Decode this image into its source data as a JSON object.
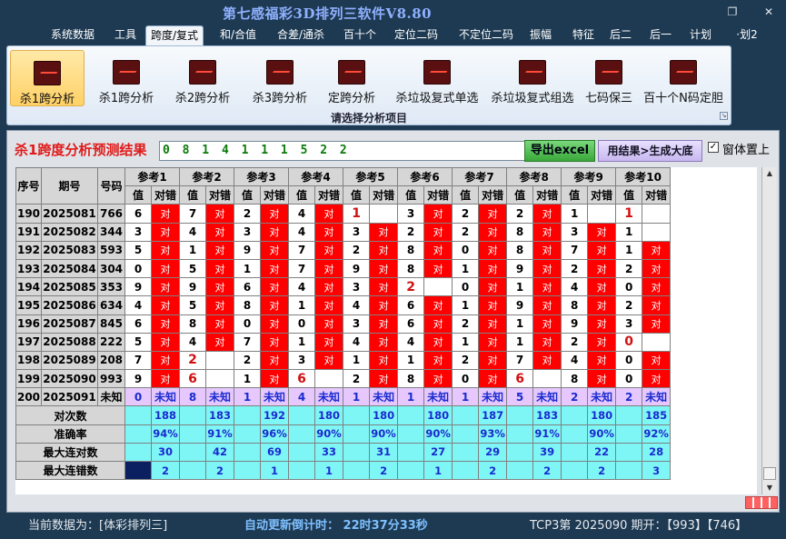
{
  "window": {
    "title": "第七感福彩3D排列三软件V8.80",
    "restore_icon": "restore-icon",
    "close_icon": "close-icon"
  },
  "menu": [
    "系统数据",
    "工具",
    "跨度/复式",
    "和/合值",
    "合差/通杀",
    "百十个",
    "定位二码",
    "不定位二码",
    "振幅",
    "特征",
    "后二",
    "后一",
    "计划",
    "·划2"
  ],
  "menu_active_index": 2,
  "ribbon": {
    "buttons": [
      "杀1跨分析",
      "杀1跨分析",
      "杀2跨分析",
      "杀3跨分析",
      "定跨分析",
      "杀垃圾复式单选",
      "杀垃圾复式组选",
      "七码保三",
      "百十个N码定胆"
    ],
    "selected_index": 0,
    "caption": "请选择分析项目"
  },
  "panel": {
    "heading": "杀1跨度分析预测结果",
    "result_value": "0 8 1 4 1 1 1 5 2 2",
    "excel_button": "导出excel",
    "generate_button": "用结果>生成大底",
    "topmost_checkbox_checked": true,
    "topmost_label": "窗体置上"
  },
  "table": {
    "headers": {
      "seq": "序号",
      "period": "期号",
      "number": "号码",
      "refs": [
        "参考1",
        "参考2",
        "参考3",
        "参考4",
        "参考5",
        "参考6",
        "参考7",
        "参考8",
        "参考9",
        "参考10"
      ],
      "sub_value": "值",
      "sub_result": "对错"
    },
    "hit_text": "对",
    "rows": [
      {
        "seq": "190",
        "period": "2025081",
        "number": "766",
        "cells": [
          [
            "6",
            "对"
          ],
          [
            "7",
            "对"
          ],
          [
            "2",
            "对"
          ],
          [
            "4",
            "对"
          ],
          [
            "1",
            ""
          ],
          [
            "3",
            "对"
          ],
          [
            "2",
            "对"
          ],
          [
            "2",
            "对"
          ],
          [
            "1",
            ""
          ],
          [
            "1",
            ""
          ]
        ]
      },
      {
        "seq": "191",
        "period": "2025082",
        "number": "344",
        "cells": [
          [
            "3",
            "对"
          ],
          [
            "4",
            "对"
          ],
          [
            "3",
            "对"
          ],
          [
            "4",
            "对"
          ],
          [
            "3",
            "对"
          ],
          [
            "2",
            "对"
          ],
          [
            "2",
            "对"
          ],
          [
            "8",
            "对"
          ],
          [
            "3",
            "对"
          ],
          [
            "1",
            ""
          ]
        ]
      },
      {
        "seq": "192",
        "period": "2025083",
        "number": "593",
        "cells": [
          [
            "5",
            "对"
          ],
          [
            "1",
            "对"
          ],
          [
            "9",
            "对"
          ],
          [
            "7",
            "对"
          ],
          [
            "2",
            "对"
          ],
          [
            "8",
            "对"
          ],
          [
            "0",
            "对"
          ],
          [
            "8",
            "对"
          ],
          [
            "7",
            "对"
          ],
          [
            "1",
            "对"
          ]
        ]
      },
      {
        "seq": "193",
        "period": "2025084",
        "number": "304",
        "cells": [
          [
            "0",
            "对"
          ],
          [
            "5",
            "对"
          ],
          [
            "1",
            "对"
          ],
          [
            "7",
            "对"
          ],
          [
            "9",
            "对"
          ],
          [
            "8",
            "对"
          ],
          [
            "1",
            "对"
          ],
          [
            "9",
            "对"
          ],
          [
            "2",
            "对"
          ],
          [
            "2",
            "对"
          ]
        ]
      },
      {
        "seq": "194",
        "period": "2025085",
        "number": "353",
        "cells": [
          [
            "9",
            "对"
          ],
          [
            "9",
            "对"
          ],
          [
            "6",
            "对"
          ],
          [
            "4",
            "对"
          ],
          [
            "3",
            "对"
          ],
          [
            "2",
            ""
          ],
          [
            "0",
            "对"
          ],
          [
            "1",
            "对"
          ],
          [
            "4",
            "对"
          ],
          [
            "0",
            "对"
          ]
        ]
      },
      {
        "seq": "195",
        "period": "2025086",
        "number": "634",
        "cells": [
          [
            "4",
            "对"
          ],
          [
            "5",
            "对"
          ],
          [
            "8",
            "对"
          ],
          [
            "1",
            "对"
          ],
          [
            "4",
            "对"
          ],
          [
            "6",
            "对"
          ],
          [
            "1",
            "对"
          ],
          [
            "9",
            "对"
          ],
          [
            "8",
            "对"
          ],
          [
            "2",
            "对"
          ]
        ]
      },
      {
        "seq": "196",
        "period": "2025087",
        "number": "845",
        "cells": [
          [
            "6",
            "对"
          ],
          [
            "8",
            "对"
          ],
          [
            "0",
            "对"
          ],
          [
            "0",
            "对"
          ],
          [
            "3",
            "对"
          ],
          [
            "6",
            "对"
          ],
          [
            "2",
            "对"
          ],
          [
            "1",
            "对"
          ],
          [
            "9",
            "对"
          ],
          [
            "3",
            "对"
          ]
        ]
      },
      {
        "seq": "197",
        "period": "2025088",
        "number": "222",
        "cells": [
          [
            "5",
            "对"
          ],
          [
            "4",
            "对"
          ],
          [
            "7",
            "对"
          ],
          [
            "1",
            "对"
          ],
          [
            "4",
            "对"
          ],
          [
            "4",
            "对"
          ],
          [
            "1",
            "对"
          ],
          [
            "1",
            "对"
          ],
          [
            "2",
            "对"
          ],
          [
            "0",
            ""
          ]
        ]
      },
      {
        "seq": "198",
        "period": "2025089",
        "number": "208",
        "cells": [
          [
            "7",
            "对"
          ],
          [
            "2",
            ""
          ],
          [
            "2",
            "对"
          ],
          [
            "3",
            "对"
          ],
          [
            "1",
            "对"
          ],
          [
            "1",
            "对"
          ],
          [
            "2",
            "对"
          ],
          [
            "7",
            "对"
          ],
          [
            "4",
            "对"
          ],
          [
            "0",
            "对"
          ]
        ]
      },
      {
        "seq": "199",
        "period": "2025090",
        "number": "993",
        "cells": [
          [
            "9",
            "对"
          ],
          [
            "6",
            ""
          ],
          [
            "1",
            "对"
          ],
          [
            "6",
            ""
          ],
          [
            "2",
            "对"
          ],
          [
            "8",
            "对"
          ],
          [
            "0",
            "对"
          ],
          [
            "6",
            ""
          ],
          [
            "8",
            "对"
          ],
          [
            "0",
            "对"
          ]
        ]
      }
    ],
    "red_values": [
      [
        0,
        4
      ],
      [
        0,
        9
      ],
      [
        4,
        5
      ],
      [
        7,
        9
      ],
      [
        8,
        1
      ],
      [
        9,
        1
      ],
      [
        9,
        3
      ],
      [
        9,
        7
      ]
    ],
    "pending_row": {
      "seq": "200",
      "period": "2025091",
      "number": "未知",
      "values": [
        "0",
        "8",
        "1",
        "4",
        "1",
        "1",
        "1",
        "5",
        "2",
        "2"
      ],
      "result": "未知"
    },
    "stats": [
      {
        "label": "对次数",
        "values": [
          "188",
          "183",
          "192",
          "180",
          "180",
          "180",
          "187",
          "183",
          "180",
          "185"
        ]
      },
      {
        "label": "准确率",
        "values": [
          "94%",
          "91%",
          "96%",
          "90%",
          "90%",
          "90%",
          "93%",
          "91%",
          "90%",
          "92%"
        ]
      },
      {
        "label": "最大连对数",
        "values": [
          "30",
          "42",
          "69",
          "33",
          "31",
          "27",
          "29",
          "39",
          "22",
          "28"
        ]
      },
      {
        "label": "最大连错数",
        "values": [
          "2",
          "2",
          "1",
          "1",
          "2",
          "1",
          "2",
          "2",
          "2",
          "3"
        ]
      }
    ]
  },
  "statusbar": {
    "current_data": "当前数据为：[体彩排列三]",
    "countdown": "自动更新倒计时： 22时37分33秒",
    "draw_info": "TCP3第 2025090 期开：【993】【746】"
  }
}
